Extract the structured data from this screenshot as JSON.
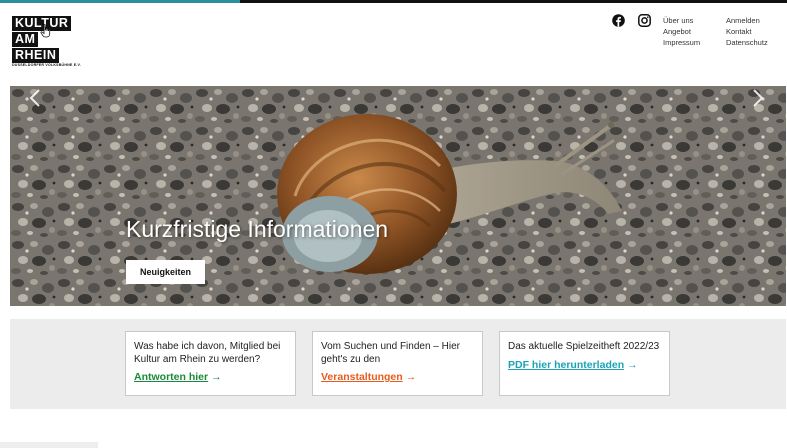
{
  "header": {
    "logo": {
      "lines": [
        "KULTUR",
        "AM",
        "RHEIN"
      ],
      "tagline": "DÜSSELDORFER VOLKSBÜHNE E.V."
    },
    "social": [
      "facebook-icon",
      "instagram-icon"
    ],
    "nav_col1": [
      "Über uns",
      "Angebot",
      "Impressum"
    ],
    "nav_col2": [
      "Anmelden",
      "Kontakt",
      "Datenschutz"
    ]
  },
  "hero": {
    "title": "Kurzfristige Informationen",
    "button_label": "Neuigkeiten",
    "prev_icon": "arrow-left-icon",
    "next_icon": "arrow-right-icon"
  },
  "cards": [
    {
      "text": "Was habe ich davon, Mitglied bei Kultur am Rhein zu werden?",
      "link": "Antworten hier",
      "arrow": "→",
      "color": "#1b8a3a"
    },
    {
      "text": "Vom Suchen und Finden – Hier geht's zu den",
      "link": "Veranstaltungen",
      "arrow": "→",
      "color": "#e85b1e"
    },
    {
      "text": "Das aktuelle Spielzeitheft 2022/23",
      "link": "PDF hier herunterladen",
      "arrow": "→",
      "color": "#1aa3b8"
    }
  ],
  "colors": {
    "accent": "#2a8fa0",
    "infobar_bg": "#ececec"
  }
}
